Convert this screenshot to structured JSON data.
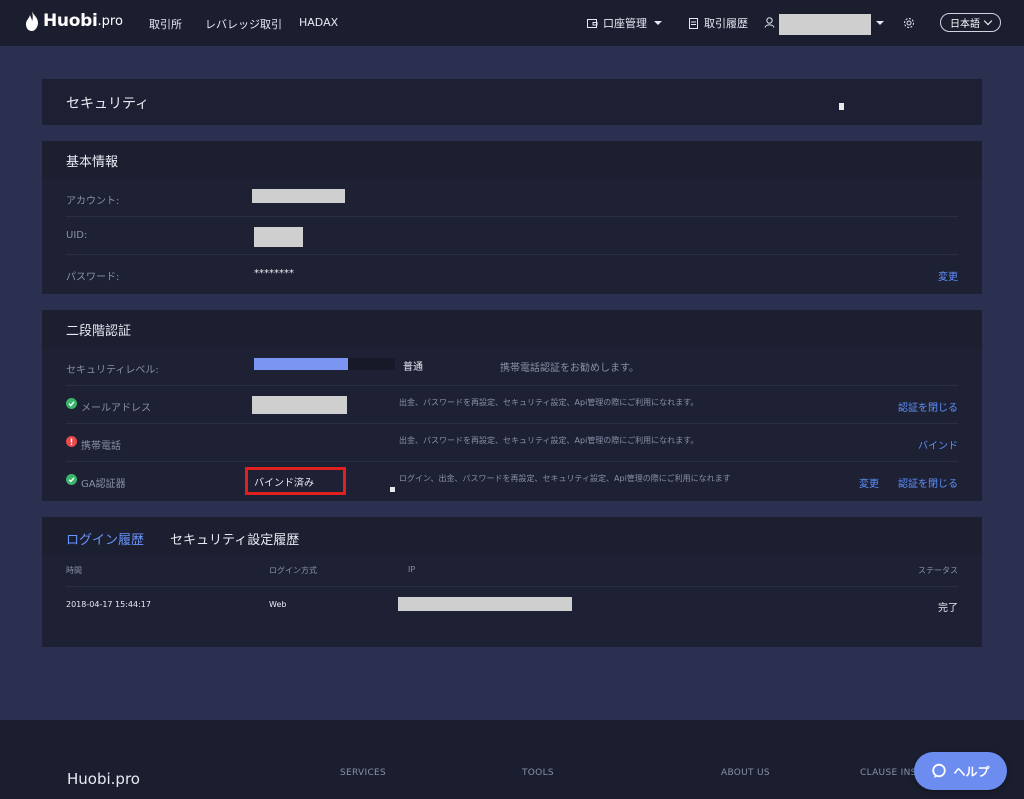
{
  "header": {
    "logo_brand": "Huobi",
    "logo_suffix": ".pro",
    "nav": [
      "取引所",
      "レバレッジ取引",
      "HADAX"
    ],
    "account_menu": "口座管理",
    "trade_history": "取引履歴",
    "language": "日本語"
  },
  "page": {
    "title": "セキュリティ"
  },
  "basic_info": {
    "title": "基本情報",
    "account_label": "アカウント:",
    "uid_label": "UID:",
    "password_label": "パスワード:",
    "password_value": "********",
    "change_link": "変更"
  },
  "two_factor": {
    "title": "二段階認証",
    "security_level_label": "セキュリティレベル:",
    "security_level_value": "普通",
    "security_level_fraction": 0.67,
    "security_level_hint": "携帯電話認証をお勧めします。",
    "email_label": "メールアドレス",
    "email_desc": "出金、パスワードを再設定、セキュリティ設定、Api管理の際にご利用になれます。",
    "email_action": "認証を閉じる",
    "phone_label": "携帯電話",
    "phone_desc": "出金、パスワードを再設定、セキュリティ設定、Api管理の際にご利用になれます。",
    "phone_action": "バインド",
    "ga_label": "GA認証器",
    "ga_status": "バインド済み",
    "ga_desc": "ログイン、出金、パスワードを再設定、セキュリティ設定、Api管理の際にご利用になれます",
    "ga_change": "変更",
    "ga_action": "認証を閉じる"
  },
  "history": {
    "tab_login": "ログイン履歴",
    "tab_security": "セキュリティ設定履歴",
    "columns": [
      "時間",
      "ログイン方式",
      "IP",
      "ステータス"
    ],
    "rows": [
      {
        "time": "2018-04-17 15:44:17",
        "method": "Web",
        "status": "完了"
      }
    ]
  },
  "footer": {
    "logo": "Huobi.pro",
    "columns": [
      "SERVICES",
      "TOOLS",
      "ABOUT US",
      "CLAUSE INS"
    ]
  },
  "help_button": "ヘルプ",
  "colors": {
    "accent": "#5f8fff",
    "success": "#3bb56b",
    "danger": "#e84b4b",
    "highlight_border": "#e0201c"
  }
}
